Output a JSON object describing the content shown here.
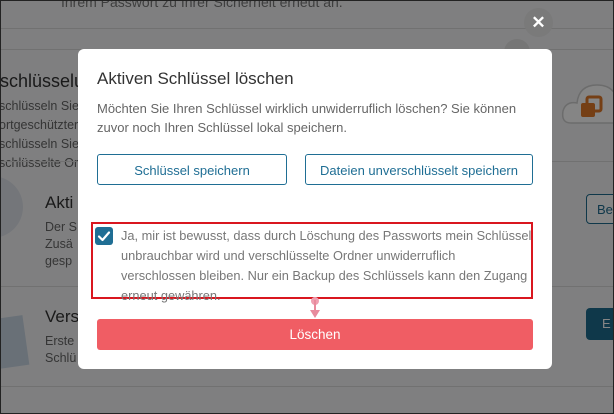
{
  "background": {
    "top_text": "Ihrem Passwort zu Ihrer Sicherheit erneut an.",
    "heading": "sschlüsselung",
    "lines": [
      "schlüsseln Sie ei",
      "ortgeschützter",
      "schlüsseln Sie au",
      "schlüsselte Ordn"
    ],
    "item1_title": "Akti",
    "item1_lines": [
      "Der S",
      "Zusä",
      "gesp"
    ],
    "item1_button": "Be",
    "item2_title": "Vers",
    "item2_lines": [
      "Erste",
      "Schlü"
    ],
    "item2_button": "E"
  },
  "modal": {
    "close_symbol": "✕",
    "title": "Aktiven Schlüssel löschen",
    "description": "Möchten Sie Ihren Schlüssel wirklich unwiderruflich löschen? Sie können zuvor noch Ihren Schlüssel lokal speichern.",
    "save_key_label": "Schlüssel speichern",
    "save_plain_label": "Dateien unverschlüsselt speichern",
    "confirm_text": "Ja, mir ist bewusst, dass durch Löschung des Passworts mein Schlüssel unbrauchbar wird und verschlüsselte Ordner unwiderruflich verschlossen bleiben. Nur ein Backup des Schlüssels kann den Zugang erneut gewähren.",
    "confirm_checked": true,
    "delete_label": "Löschen"
  },
  "colors": {
    "primary": "#1f6e94",
    "danger": "#f05d64",
    "highlight": "#d9161f",
    "cloud_accent": "#e07a2a"
  },
  "icons": {
    "close": "close-icon",
    "checkbox": "check-icon",
    "cloud": "cloud-icon"
  }
}
